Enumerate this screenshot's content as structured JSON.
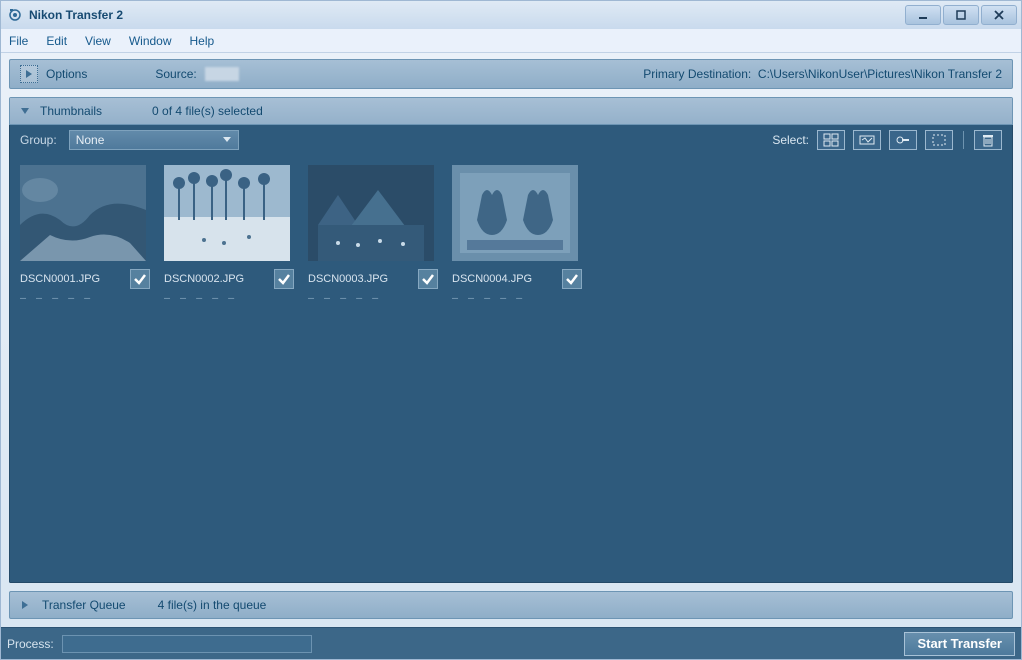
{
  "window": {
    "title": "Nikon Transfer 2"
  },
  "menu": {
    "items": [
      "File",
      "Edit",
      "View",
      "Window",
      "Help"
    ]
  },
  "options_bar": {
    "options_label": "Options",
    "source_label": "Source:",
    "destination_label": "Primary Destination:",
    "destination_path": "C:\\Users\\NikonUser\\Pictures\\Nikon Transfer 2"
  },
  "thumbnails": {
    "title": "Thumbnails",
    "selection_status": "0 of 4 file(s) selected",
    "group_label": "Group:",
    "group_value": "None",
    "select_label": "Select:",
    "files": [
      {
        "name": "DSCN0001.JPG",
        "checked": true
      },
      {
        "name": "DSCN0002.JPG",
        "checked": true
      },
      {
        "name": "DSCN0003.JPG",
        "checked": true
      },
      {
        "name": "DSCN0004.JPG",
        "checked": true
      }
    ]
  },
  "queue": {
    "title": "Transfer Queue",
    "status": "4 file(s) in the queue"
  },
  "footer": {
    "process_label": "Process:",
    "start_button": "Start Transfer"
  }
}
